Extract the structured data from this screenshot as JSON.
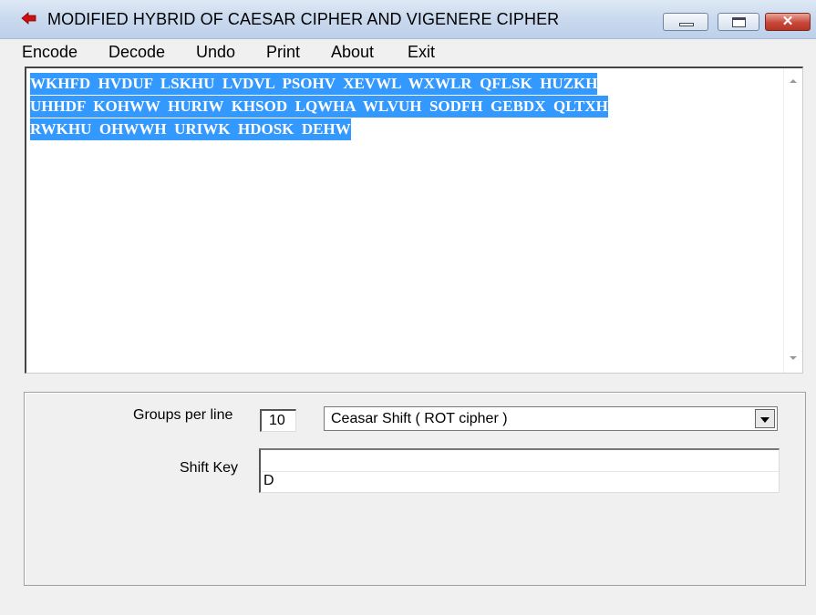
{
  "window": {
    "title": "MODIFIED HYBRID OF CAESAR CIPHER AND VIGENERE CIPHER",
    "close_glyph": "✕"
  },
  "menu": [
    "Encode",
    "Decode",
    "Undo",
    "Print",
    "About",
    "Exit"
  ],
  "editor": {
    "lines": [
      "WKHFD  HVDUF  LSKHU  LVDVL  PSOHV  XEVWL  WXWLR  QFLSK  HUZKH",
      "UHHDF  KOHWW  HURIW  KHSOD  LQWHA  WLVUH  SODFH  GEBDX  QLTXH",
      "RWKHU  OHWWH  URIWK  HDOSK  DEHW"
    ]
  },
  "options": {
    "groups_label": "Groups per line",
    "groups_value": "10",
    "cipher_selected": "Ceasar Shift ( ROT cipher )",
    "shift_key_label": "Shift Key",
    "shift_key_value": "D"
  },
  "colors": {
    "selection": "#3399ff",
    "close_button": "#c9473a"
  }
}
